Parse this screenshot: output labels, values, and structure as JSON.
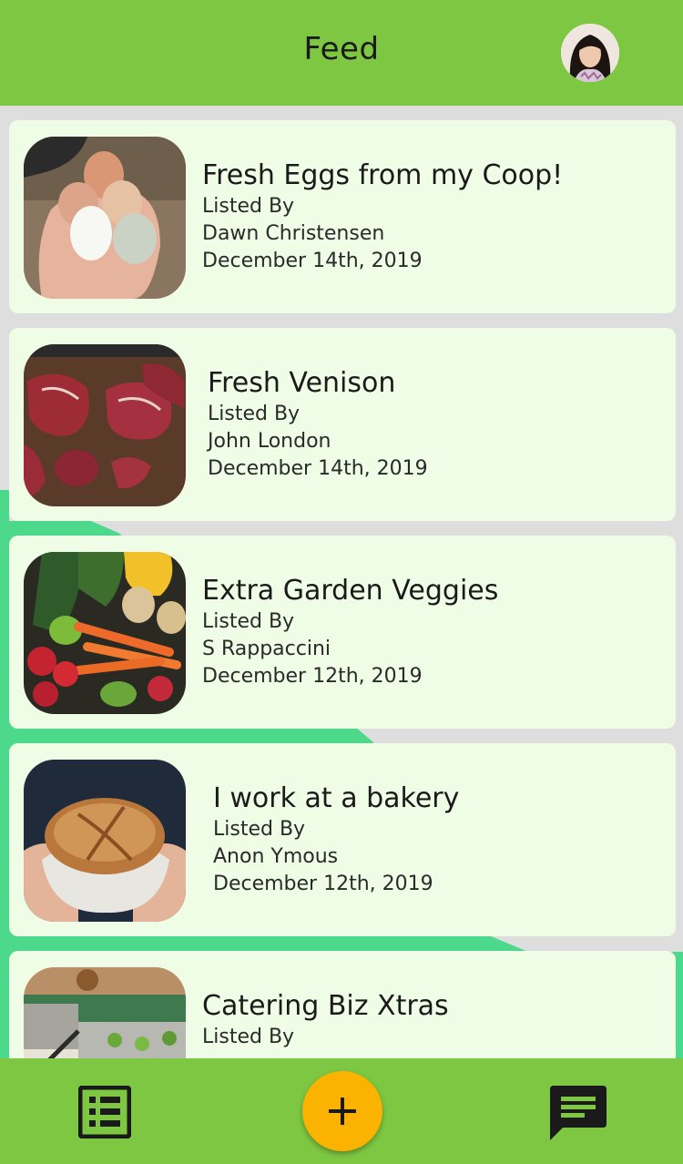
{
  "header": {
    "title": "Feed"
  },
  "feed": {
    "items": [
      {
        "title": "Fresh Eggs from my Coop!",
        "listed_by_label": "Listed By",
        "author": "Dawn Christensen",
        "date": "December 14th, 2019",
        "image": "eggs-photo"
      },
      {
        "title": "Fresh Venison",
        "listed_by_label": "Listed By",
        "author": "John London",
        "date": "December 14th, 2019",
        "image": "venison-photo"
      },
      {
        "title": "Extra Garden Veggies",
        "listed_by_label": "Listed By",
        "author": "S Rappaccini",
        "date": "December 12th, 2019",
        "image": "veggies-photo"
      },
      {
        "title": "I work at a bakery",
        "listed_by_label": "Listed By",
        "author": "Anon Ymous",
        "date": "December 12th, 2019",
        "image": "bread-photo"
      },
      {
        "title": "Catering Biz Xtras",
        "listed_by_label": "Listed By",
        "author": "",
        "date": "",
        "image": "catering-photo"
      }
    ]
  },
  "bottom_nav": {
    "left_icon": "list-icon",
    "center_icon": "plus-icon",
    "right_icon": "chat-icon"
  },
  "colors": {
    "bar": "#7dc742",
    "card": "#f0fde6",
    "accent_green": "#4dd98b",
    "fab": "#fbb200",
    "background": "#dedede"
  }
}
